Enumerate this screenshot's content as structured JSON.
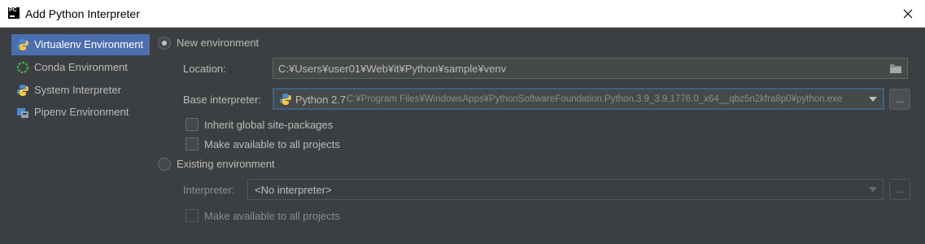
{
  "window": {
    "title": "Add Python Interpreter",
    "app_icon_text": "PC",
    "close_icon": "close-icon"
  },
  "sidebar": {
    "items": [
      {
        "label": "Virtualenv Environment",
        "icon": "virtualenv-icon",
        "active": true
      },
      {
        "label": "Conda Environment",
        "icon": "conda-icon",
        "active": false
      },
      {
        "label": "System Interpreter",
        "icon": "python-icon",
        "active": false
      },
      {
        "label": "Pipenv Environment",
        "icon": "pipenv-icon",
        "active": false
      }
    ]
  },
  "new_env": {
    "radio_label": "New environment",
    "selected": true,
    "location_label": "Location:",
    "location_value": "C:¥Users¥user01¥Web¥it¥Python¥sample¥venv",
    "base_label": "Base interpreter:",
    "base_version": "Python 2.7",
    "base_path": "C:¥Program Files¥WindowsApps¥PythonSoftwareFoundation.Python.3.9_3.9.1776.0_x64__qbz5n2kfra8p0¥python.exe",
    "browse_label": "...",
    "inherit_label": "Inherit global site-packages",
    "inherit_checked": false,
    "make_available_label": "Make available to all projects",
    "make_available_checked": false
  },
  "existing_env": {
    "radio_label": "Existing environment",
    "selected": false,
    "interpreter_label": "Interpreter:",
    "interpreter_value": "<No interpreter>",
    "browse_label": "...",
    "make_available_label": "Make available to all projects",
    "make_available_checked": false
  },
  "colors": {
    "background": "#3c3f41",
    "selection": "#4b6eaf",
    "field": "#45494a",
    "focus_border": "#3d6185",
    "text": "#bbbbbb",
    "text_disabled": "#8c8c8c"
  }
}
